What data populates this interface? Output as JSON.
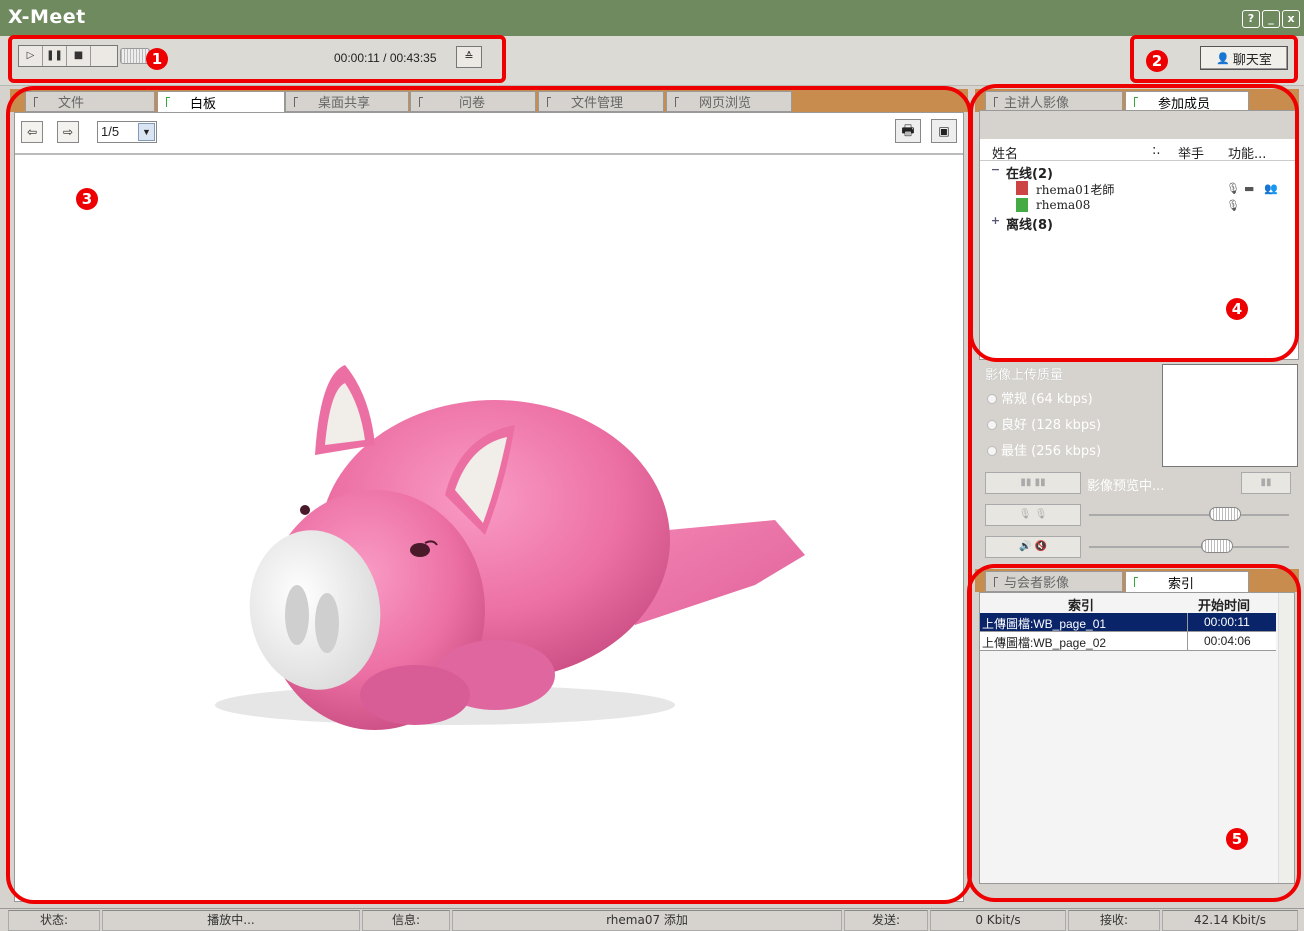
{
  "window": {
    "title": "X-Meet",
    "help_label": "?",
    "minimize_label": "_",
    "close_label": "x"
  },
  "player": {
    "play_icon": "play-icon",
    "pause_icon": "pause-icon",
    "stop_icon": "stop-icon",
    "timecode": "00:00:11 / 00:43:35",
    "eject_label": "≙"
  },
  "chat": {
    "label": "聊天室"
  },
  "main_tabs": [
    {
      "label": "文件"
    },
    {
      "label": "白板"
    },
    {
      "label": "桌面共享"
    },
    {
      "label": "问卷"
    },
    {
      "label": "文件管理"
    },
    {
      "label": "网页浏览"
    }
  ],
  "whiteboard": {
    "prev_label": "⇦",
    "next_label": "⇨",
    "page": "1/5"
  },
  "right_tabs": [
    {
      "label": "主讲人影像"
    },
    {
      "label": "参加成员"
    }
  ],
  "members": {
    "columns": {
      "name": "姓名",
      "dots": ":.",
      "hand": "举手",
      "func": "功能..."
    },
    "online_label": "在线(2)",
    "offline_label": "离线(8)",
    "people": [
      {
        "name": "rhema01老師"
      },
      {
        "name": "rhema08"
      }
    ]
  },
  "quality": {
    "title": "影像上传质量",
    "options": [
      "常规 (64 kbps)",
      "良好 (128 kbps)",
      "最佳 (256 kbps)"
    ],
    "preview_label": "影像预览中..."
  },
  "index_tabs": [
    {
      "label": "与会者影像"
    },
    {
      "label": "索引"
    }
  ],
  "index_table": {
    "columns": {
      "index": "索引",
      "start": "开始时间"
    },
    "rows": [
      {
        "name": "上傳圖檔:WB_page_01",
        "time": "00:00:11"
      },
      {
        "name": "上傳圖檔:WB_page_02",
        "time": "00:04:06"
      }
    ]
  },
  "status": {
    "state_label": "状态:",
    "state_value": "播放中...",
    "info_label": "信息:",
    "info_value": "rhema07 添加",
    "send_label": "发送:",
    "send_value": "0 Kbit/s",
    "recv_label": "接收:",
    "recv_value": "42.14 Kbit/s"
  },
  "annotations": [
    "1",
    "2",
    "3",
    "4",
    "5"
  ],
  "colors": {
    "title_bar": "#6f8a5e",
    "tab_strip": "#c98c4f",
    "annotation": "#e00000",
    "selection": "#0a246a"
  }
}
